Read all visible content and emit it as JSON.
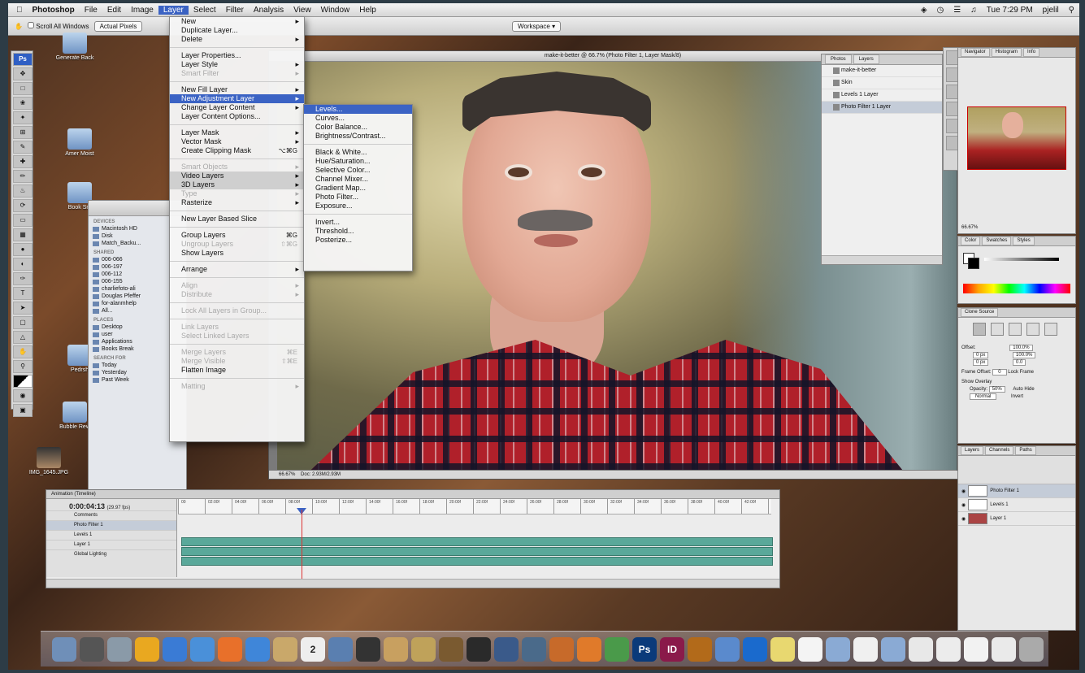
{
  "menubar": {
    "app_name": "Photoshop",
    "menus": [
      "File",
      "Edit",
      "Image",
      "Layer",
      "Select",
      "Filter",
      "Analysis",
      "View",
      "Window",
      "Help"
    ],
    "clock": "Tue 7:29 PM",
    "user": "pjelil"
  },
  "optbar": {
    "scroll_all": "Scroll All Windows",
    "actual_pixels": "Actual Pixels",
    "workspace": "Workspace"
  },
  "desktop_icons": [
    "Generate Back",
    "Amer Moist",
    "Book Sm",
    "Pedrsh",
    "Bubble Rew",
    "IMG_1645.JPG"
  ],
  "finder": {
    "devices_header": "DEVICES",
    "devices": [
      "Macintosh HD",
      "Disk",
      "Match_Backu..."
    ],
    "shared_header": "SHARED",
    "shared": [
      "006-066",
      "006-197",
      "006-112",
      "006-155",
      "charliefoto-ali",
      "Douglas Pfeffer",
      "for-alanmhelp",
      "All..."
    ],
    "places_header": "PLACES",
    "places": [
      "Desktop",
      "user",
      "Applications",
      "Books Break"
    ],
    "search_header": "SEARCH FOR",
    "search": [
      "Today",
      "Yesterday",
      "Past Week"
    ]
  },
  "layer_menu": {
    "items": [
      {
        "label": "New",
        "sub": true
      },
      {
        "label": "Duplicate Layer..."
      },
      {
        "label": "Delete",
        "sub": true
      },
      {
        "sep": true
      },
      {
        "label": "Layer Properties..."
      },
      {
        "label": "Layer Style",
        "sub": true
      },
      {
        "label": "Smart Filter",
        "sub": true,
        "disabled": true
      },
      {
        "sep": true
      },
      {
        "label": "New Fill Layer",
        "sub": true
      },
      {
        "label": "New Adjustment Layer",
        "sub": true,
        "highlight": true
      },
      {
        "label": "Change Layer Content",
        "sub": true
      },
      {
        "label": "Layer Content Options..."
      },
      {
        "sep": true
      },
      {
        "label": "Layer Mask",
        "sub": true
      },
      {
        "label": "Vector Mask",
        "sub": true
      },
      {
        "label": "Create Clipping Mask",
        "shortcut": "⌥⌘G"
      },
      {
        "sep": true
      },
      {
        "label": "Smart Objects",
        "sub": true,
        "disabled": true
      },
      {
        "label": "Video Layers",
        "sub": true,
        "grey": true
      },
      {
        "label": "3D Layers",
        "sub": true,
        "grey": true
      },
      {
        "label": "Type",
        "sub": true,
        "disabled": true
      },
      {
        "label": "Rasterize",
        "sub": true
      },
      {
        "sep": true
      },
      {
        "label": "New Layer Based Slice"
      },
      {
        "sep": true
      },
      {
        "label": "Group Layers",
        "shortcut": "⌘G"
      },
      {
        "label": "Ungroup Layers",
        "shortcut": "⇧⌘G",
        "disabled": true
      },
      {
        "label": "Show Layers"
      },
      {
        "sep": true
      },
      {
        "label": "Arrange",
        "sub": true
      },
      {
        "sep": true
      },
      {
        "label": "Align",
        "sub": true,
        "disabled": true
      },
      {
        "label": "Distribute",
        "sub": true,
        "disabled": true
      },
      {
        "sep": true
      },
      {
        "label": "Lock All Layers in Group...",
        "disabled": true
      },
      {
        "sep": true
      },
      {
        "label": "Link Layers",
        "disabled": true
      },
      {
        "label": "Select Linked Layers",
        "disabled": true
      },
      {
        "sep": true
      },
      {
        "label": "Merge Layers",
        "shortcut": "⌘E",
        "disabled": true
      },
      {
        "label": "Merge Visible",
        "shortcut": "⇧⌘E",
        "disabled": true
      },
      {
        "label": "Flatten Image"
      },
      {
        "sep": true
      },
      {
        "label": "Matting",
        "sub": true,
        "disabled": true
      }
    ]
  },
  "adjustment_submenu": {
    "items": [
      {
        "label": "Levels...",
        "highlight": true
      },
      {
        "label": "Curves..."
      },
      {
        "label": "Color Balance..."
      },
      {
        "label": "Brightness/Contrast..."
      },
      {
        "sep": true
      },
      {
        "label": "Black & White..."
      },
      {
        "label": "Hue/Saturation..."
      },
      {
        "label": "Selective Color..."
      },
      {
        "label": "Channel Mixer..."
      },
      {
        "label": "Gradient Map..."
      },
      {
        "label": "Photo Filter..."
      },
      {
        "label": "Exposure..."
      },
      {
        "sep": true
      },
      {
        "label": "Invert..."
      },
      {
        "label": "Threshold..."
      },
      {
        "label": "Posterize..."
      }
    ]
  },
  "document": {
    "title": "make-it-better @ 66.7% (Photo Filter 1, Layer Mask/8)",
    "zoom": "66.67%",
    "doc_info": "Doc: 2.93M/2.93M"
  },
  "layers_float": {
    "tabs": [
      "Photos",
      "Layers"
    ],
    "rows": [
      "make-it-better",
      "Skin",
      "Levels 1 Layer",
      "Photo Filter 1 Layer"
    ],
    "selected": 3
  },
  "navigator": {
    "tabs": [
      "Navigator",
      "Histogram",
      "Info"
    ],
    "zoom": "66.67%"
  },
  "color": {
    "tabs": [
      "Color",
      "Swatches",
      "Styles"
    ]
  },
  "clone_source": {
    "tab": "Clone Source",
    "offset_label": "Offset:",
    "frame_offset_label": "Frame Offset:",
    "frame_offset_value": "0",
    "lock_frame": "Lock Frame",
    "show_overlay": "Show Overlay",
    "opacity_label": "Opacity:",
    "opacity_value": "50%",
    "auto_hide": "Auto Hide",
    "invert": "Invert",
    "mode": "Normal",
    "w": "100.0%",
    "h": "100.0%",
    "x": "0 px",
    "y": "0 px",
    "angle": "0.0"
  },
  "layers_panel": {
    "tabs": [
      "Layers",
      "Channels",
      "Paths"
    ],
    "rows": [
      "Photo Filter 1",
      "Levels 1",
      "Layer 1"
    ],
    "selected": 0
  },
  "timeline": {
    "tabs": "Animation (Timeline)",
    "timecode": "0:00:04:13",
    "fps": "(29.97 fps)",
    "rows": [
      "Comments",
      "Photo Filter 1",
      "Levels 1",
      "Layer 1",
      "Global Lighting"
    ],
    "ruler": [
      "00",
      "02:00f",
      "04:00f",
      "06:00f",
      "08:00f",
      "10:00f",
      "12:00f",
      "14:00f",
      "16:00f",
      "18:00f",
      "20:00f",
      "22:00f",
      "24:00f",
      "26:00f",
      "28:00f",
      "30:00f",
      "32:00f",
      "34:00f",
      "36:00f",
      "38:00f",
      "40:00f",
      "42:00f"
    ]
  },
  "dock_apps": [
    "finder-icon",
    "system-prefs-icon",
    "preview-icon",
    "itunes-icon",
    "dashboard-icon",
    "safari-icon",
    "firefox-icon",
    "ichat-icon",
    "notes-icon",
    "ical-icon",
    "iphoto-icon",
    "imovie-icon",
    "garageband-icon",
    "iweb-icon",
    "guitar-icon",
    "expose-icon",
    "spaces-icon",
    "time-machine-icon",
    "keynote-icon",
    "pages-icon",
    "numbers-icon",
    "photoshop-icon",
    "indesign-icon",
    "bridge-icon",
    "mail-icon",
    "ie-icon",
    "stickies-icon",
    "textedit-icon",
    "folder-icon",
    "doc-icon",
    "folder2-icon",
    "doc2-icon",
    "doc3-icon",
    "doc4-icon",
    "doc5-icon",
    "trash-icon"
  ],
  "dock_labels": {
    "ps": "Ps",
    "id": "ID",
    "cal": "2"
  }
}
